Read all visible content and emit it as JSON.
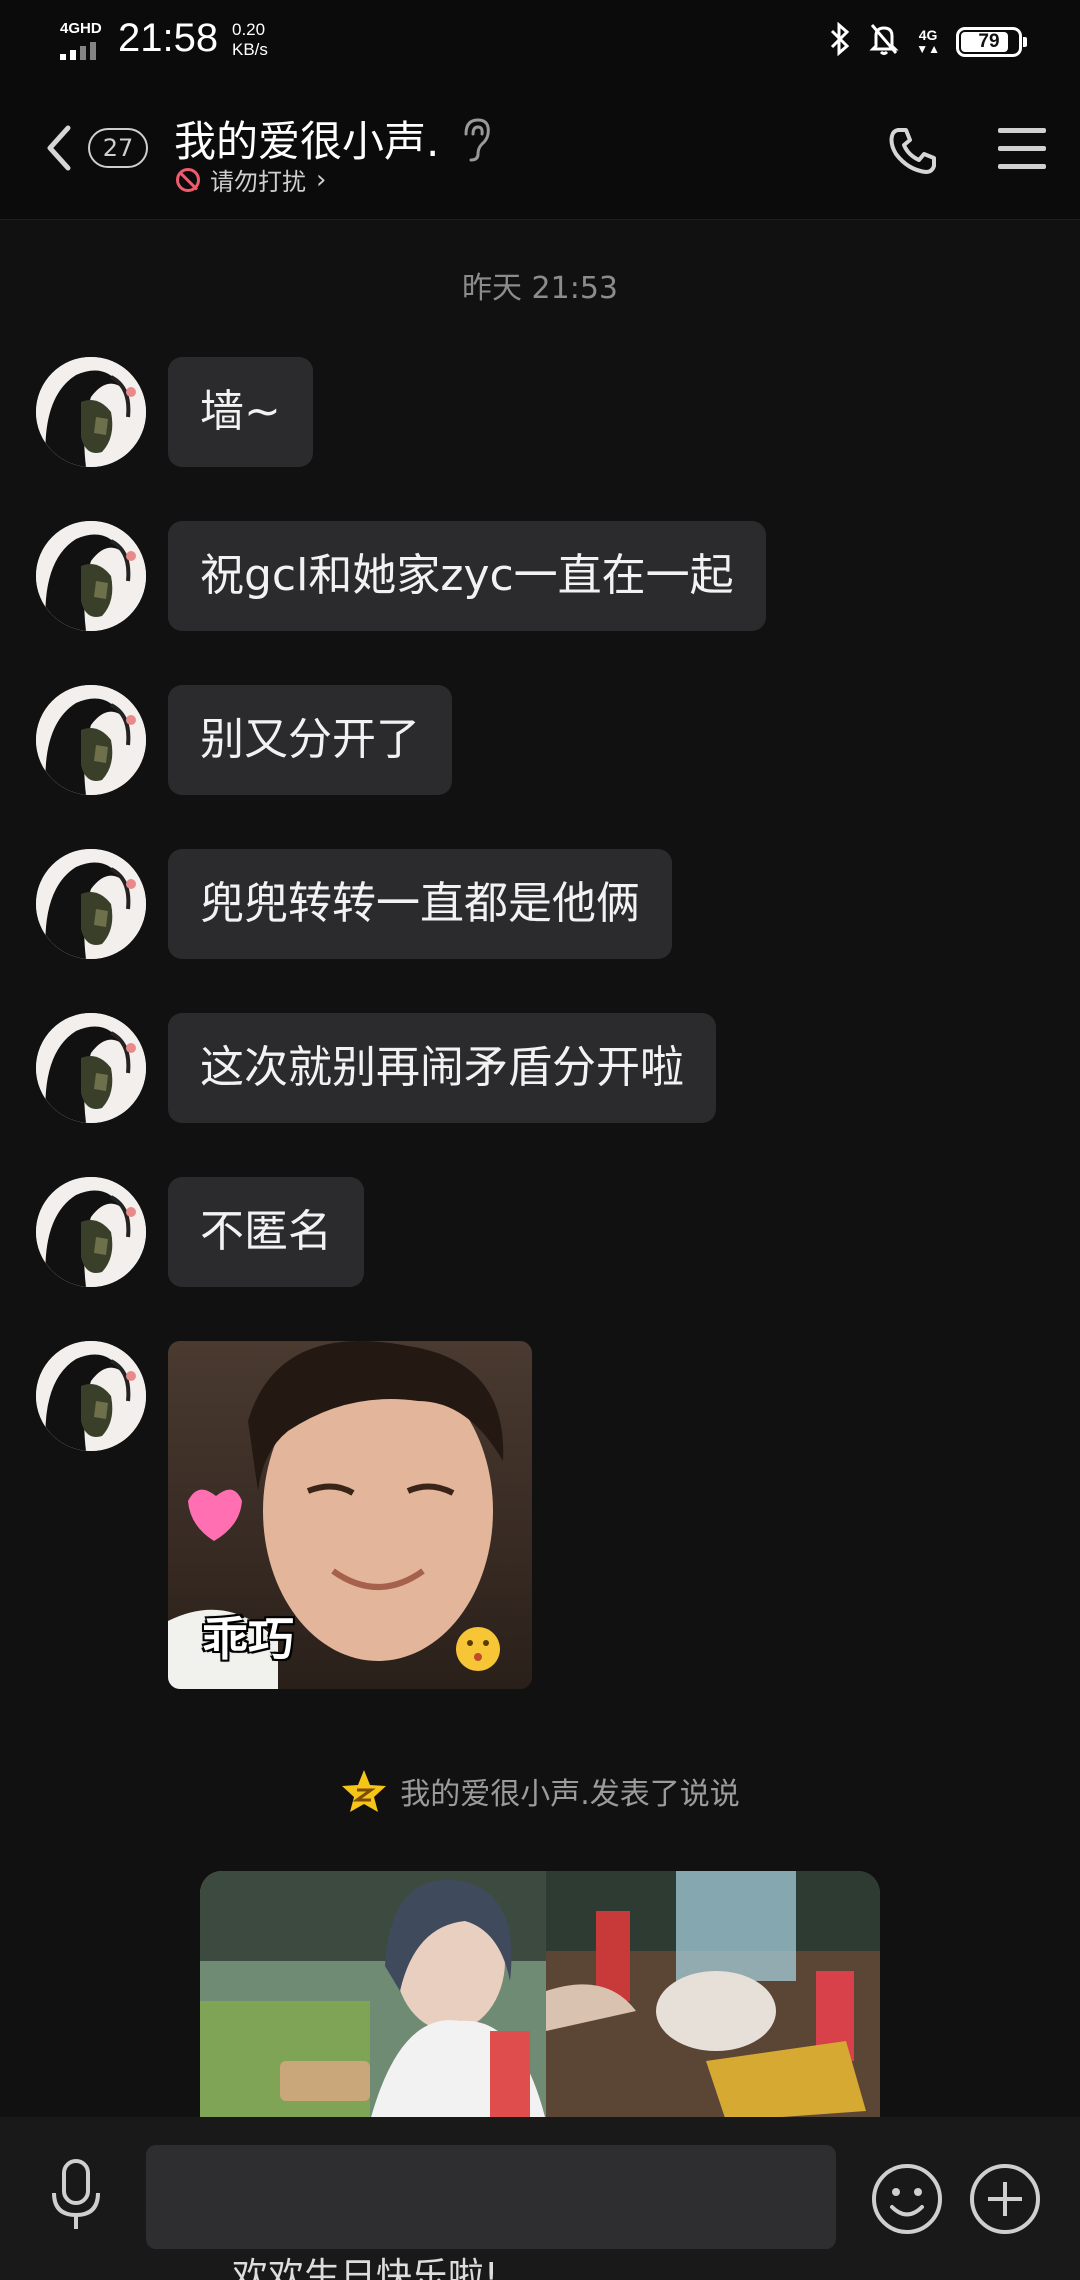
{
  "status_bar": {
    "network": "4GHD",
    "time": "21:58",
    "speed_value": "0.20",
    "speed_unit": "KB/s",
    "network_right": "4G",
    "battery_percent": "79",
    "icons": [
      "bluetooth-icon",
      "bell-muted-icon",
      "battery-icon"
    ]
  },
  "header": {
    "unread_count": "27",
    "title": "我的爱很小声.",
    "status": "请勿打扰",
    "icons": [
      "back-icon",
      "ear-icon",
      "phone-icon",
      "menu-icon"
    ]
  },
  "chat": {
    "timestamp": "昨天 21:53",
    "messages": [
      {
        "text": "墙~"
      },
      {
        "text": "祝gcl和她家zyc一直在一起"
      },
      {
        "text": "别又分开了"
      },
      {
        "text": "兜兜转转一直都是他俩"
      },
      {
        "text": "这次就别再闹矛盾分开啦"
      },
      {
        "text": "不匿名"
      }
    ],
    "sticker": {
      "caption": "乖巧"
    },
    "notice": "我的爱很小声.发表了说说",
    "share_card_text": "欢欢生日快乐啦!"
  },
  "input_bar": {
    "placeholder": "",
    "icons": [
      "microphone-icon",
      "emoji-icon",
      "plus-icon"
    ]
  },
  "colors": {
    "background": "#111112",
    "bubble": "#2b2b2d",
    "dnd": "#f05a6e",
    "star": "#f5c518"
  }
}
